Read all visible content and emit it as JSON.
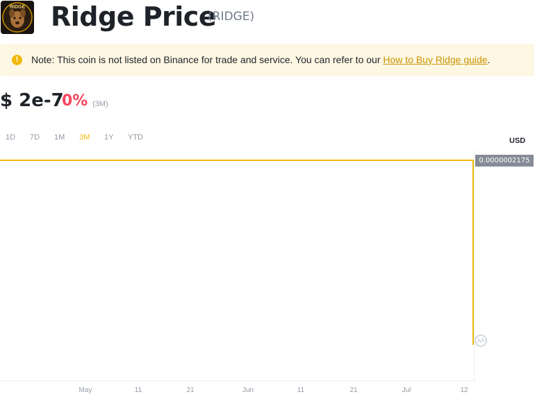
{
  "header": {
    "title": "Ridge Price",
    "ticker": "(RIDGE)",
    "logo_text": "RIDGE"
  },
  "note": {
    "text": "Note: This coin is not listed on Binance for trade and service. You can refer to our ",
    "link": "How to Buy Ridge guide",
    "suffix": ".",
    "icon": "exclamation-icon"
  },
  "price": {
    "value": "$ 2e-7",
    "change": "0%",
    "period": "(3M)"
  },
  "ranges": [
    "1D",
    "7D",
    "1M",
    "3M",
    "1Y",
    "YTD"
  ],
  "active_range": "3M",
  "currency": "USD",
  "colors": {
    "accent": "#f0b90b",
    "negative": "#f6465d",
    "muted": "#929aa5"
  },
  "chart_data": {
    "type": "line",
    "x_tick_labels": [
      "May",
      "11",
      "21",
      "Jun",
      "11",
      "21",
      "Jul",
      "12"
    ],
    "last_price_label": "0.0000002175",
    "series": [
      {
        "values": [
          2.175e-07,
          2.175e-07,
          2.175e-07,
          2.175e-07,
          2.175e-07,
          2.175e-07,
          2.175e-07,
          2.175e-07,
          2e-07
        ]
      }
    ],
    "grid": false
  }
}
